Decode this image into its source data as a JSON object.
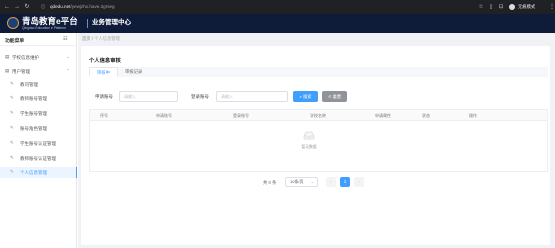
{
  "browser": {
    "url_host": "qdedu.net",
    "url_path": "/yewjzhx.have.2grseg",
    "profile_label": "无痕模式"
  },
  "header": {
    "brand": "青岛教育e平台",
    "brand_sub": "Qingdao Education e Platform",
    "center": "业务管理中心"
  },
  "sidebar": {
    "title": "功能菜单",
    "groups": [
      {
        "label": "学校信息维护"
      },
      {
        "label": "用户管理"
      }
    ],
    "items": [
      {
        "label": "教司管理"
      },
      {
        "label": "教师账号管理"
      },
      {
        "label": "学生账号管理"
      },
      {
        "label": "账号角色管理"
      },
      {
        "label": "学生账号认证管理"
      },
      {
        "label": "教师账号认证管理"
      },
      {
        "label": "个人信息管理"
      }
    ]
  },
  "breadcrumb": {
    "home": "首页",
    "sep": "/",
    "current": "个人信息管理"
  },
  "card": {
    "title": "个人信息审核",
    "tabs": [
      {
        "label": "审核中"
      },
      {
        "label": "审核记录"
      }
    ]
  },
  "filters": {
    "applicant_label": "申请账号",
    "applicant_placeholder": "请输入",
    "login_label": "登录账号",
    "login_placeholder": "请输入",
    "search_label": "搜索",
    "reset_label": "重置"
  },
  "table": {
    "columns": [
      "序号",
      "申请账号",
      "登录账号",
      "学校名称",
      "申请属性",
      "状态",
      "操作"
    ],
    "empty_text": "暂无数据"
  },
  "pagination": {
    "total": "共 0 条",
    "page_size": "10条/页",
    "current_page": "1"
  }
}
